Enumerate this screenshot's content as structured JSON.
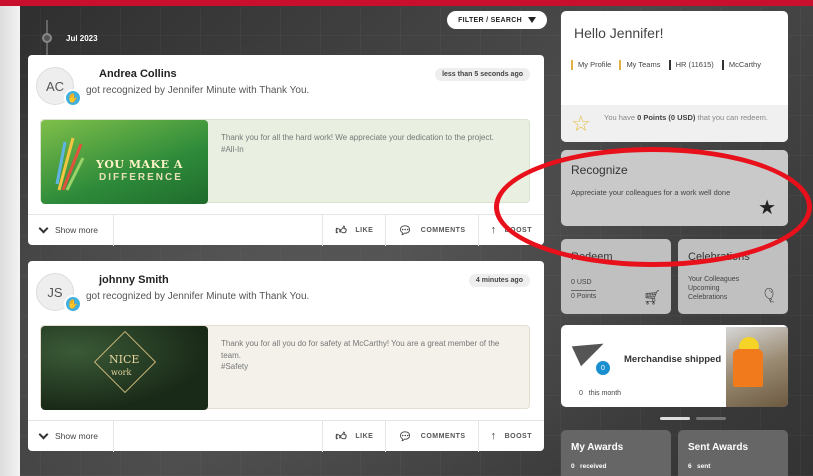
{
  "feed": {
    "filter_label": "FILTER / SEARCH",
    "month": "Jul 2023",
    "posts": [
      {
        "initials": "AC",
        "name": "Andrea Collins",
        "recognized_line": "got recognized by Jennifer Minute with Thank You.",
        "time": "less than 5 seconds ago",
        "card_line1": "YOU MAKE A",
        "card_line2": "DIFFERENCE",
        "message": "Thank you for all the hard work! We appreciate your dedication to the project.",
        "tag": "#All-In",
        "show_more": "Show more",
        "like": "LIKE",
        "comments": "COMMENTS",
        "boost": "BOOST"
      },
      {
        "initials": "JS",
        "name": "johnny Smith",
        "recognized_line": "got recognized by Jennifer Minute with Thank You.",
        "time": "4 minutes ago",
        "card_line1": "NICE",
        "card_line2": "work",
        "message": "Thank you for all you do for safety at McCarthy! You are a great member of the team.",
        "tag": "#Safety",
        "show_more": "Show more",
        "like": "LIKE",
        "comments": "COMMENTS",
        "boost": "BOOST"
      }
    ]
  },
  "profile": {
    "greeting": "Hello Jennifer!",
    "links": [
      "My Profile",
      "My Teams",
      "HR (11615)",
      "McCarthy"
    ],
    "points_prefix": "You have ",
    "points_bold": "0 Points (0 USD)",
    "points_suffix": " that you can redeem."
  },
  "recognize": {
    "title": "Recognize",
    "subtitle": "Appreciate your colleagues for a work well done"
  },
  "redeem": {
    "title": "Redeem",
    "usd": "0 USD",
    "points": "0 Points"
  },
  "celebrations": {
    "title": "Celebrations",
    "subtitle": "Your Colleagues Upcoming Celebrations"
  },
  "merch": {
    "badge": "0",
    "title": "Merchandise shipped",
    "count": "0",
    "period": "this month"
  },
  "awards": {
    "my_title": "My Awards",
    "my_count": "0",
    "my_label": "received",
    "sent_title": "Sent Awards",
    "sent_count": "6",
    "sent_label": "sent"
  },
  "colors": {
    "brand_red": "#c8102e",
    "annotation_red": "#e8101a",
    "badge_blue": "#3fb0e0"
  }
}
